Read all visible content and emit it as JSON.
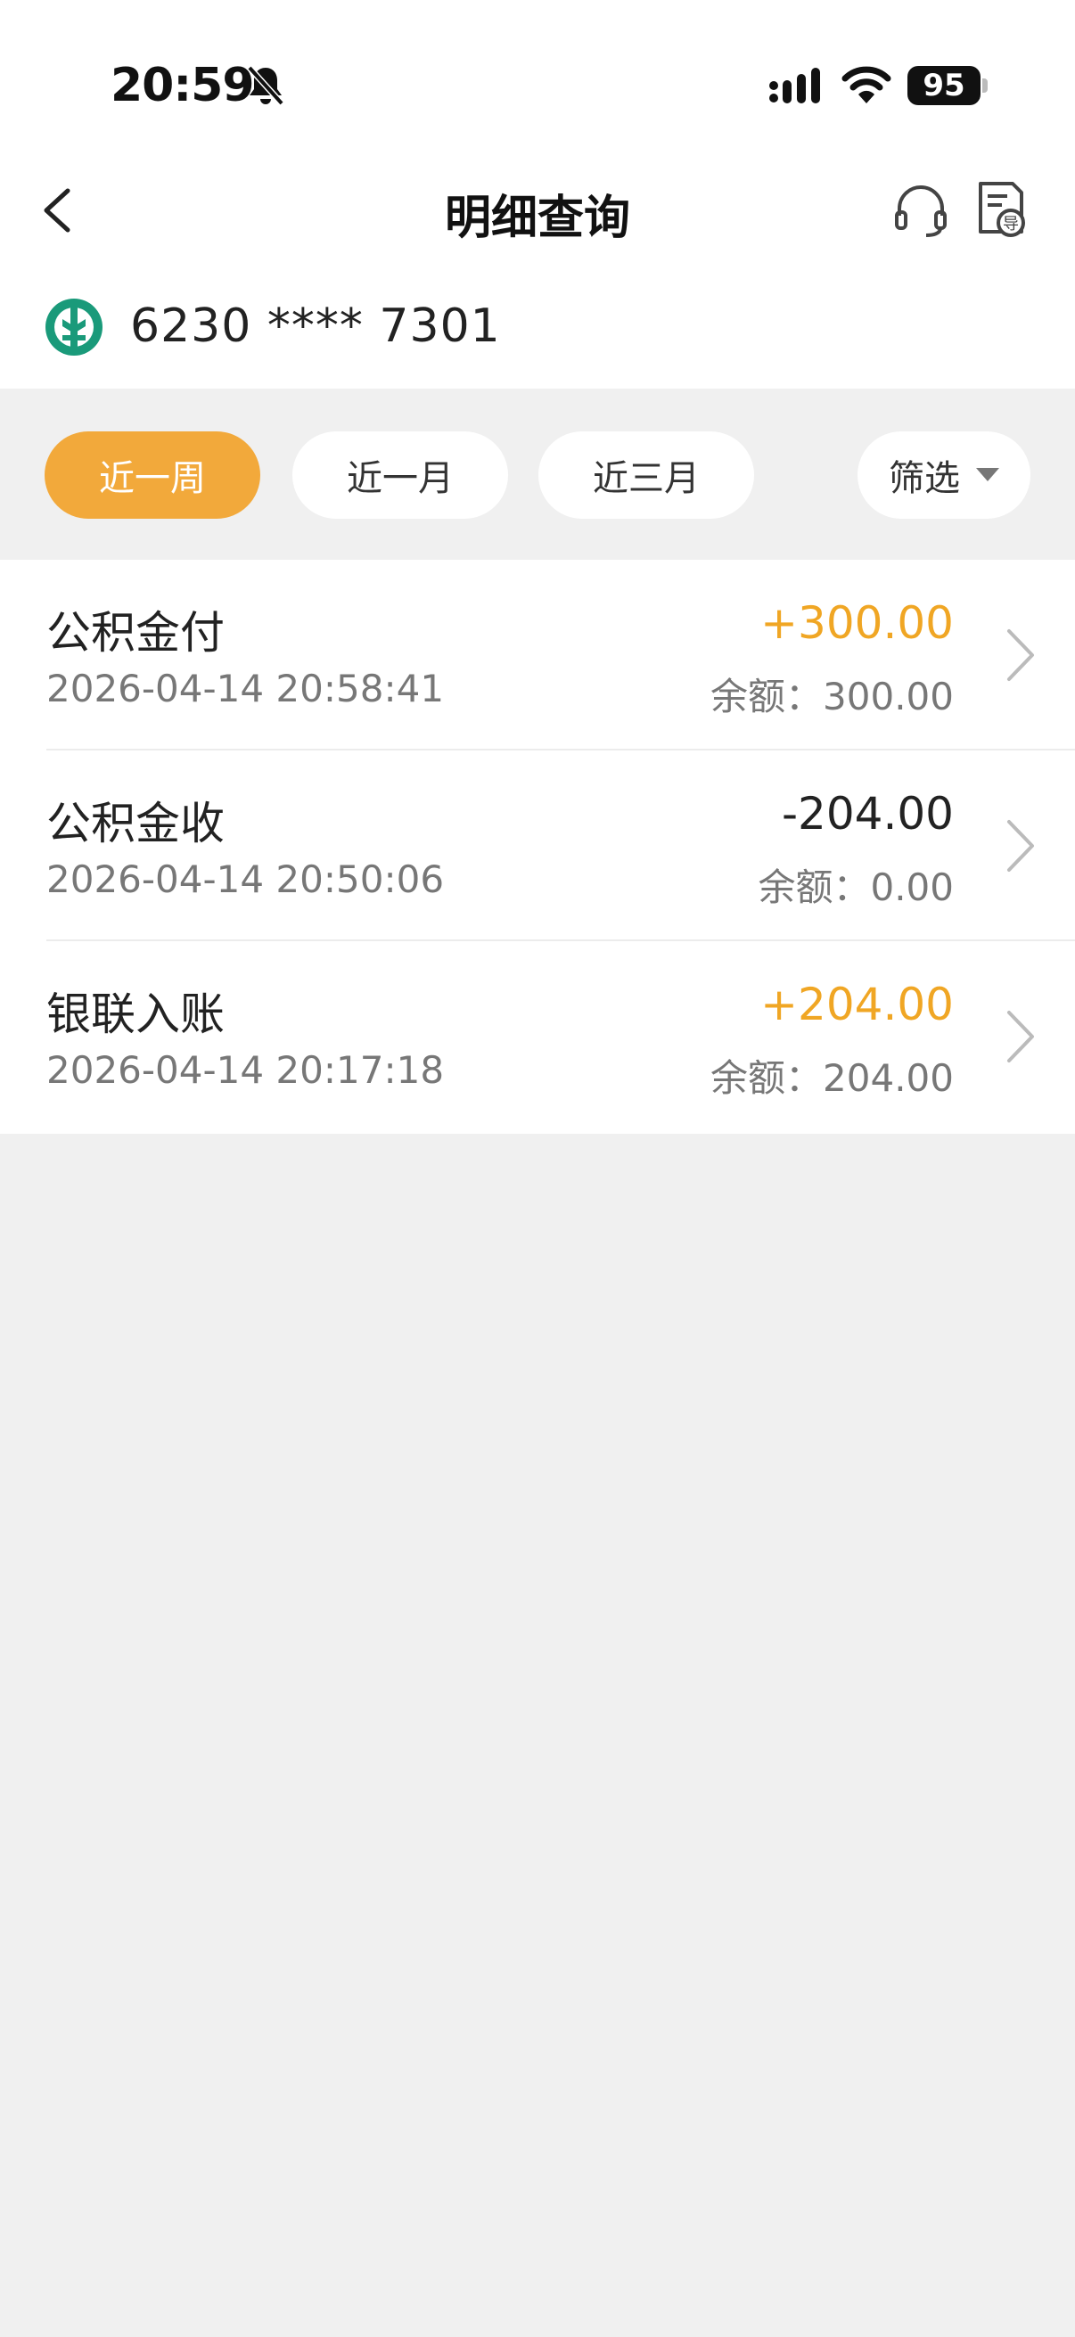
{
  "status_bar": {
    "time": "20:59",
    "battery": "95",
    "icons": [
      "bell-off-icon",
      "signal-icon",
      "wifi-icon",
      "battery-icon"
    ]
  },
  "nav": {
    "title": "明细查询",
    "icons": [
      "back-icon",
      "headset-icon",
      "export-icon"
    ]
  },
  "account": {
    "number": "6230 **** 7301",
    "logo_icon": "bank-logo-icon"
  },
  "filters": {
    "tabs": [
      {
        "label": "近一周",
        "active": true
      },
      {
        "label": "近一月",
        "active": false
      },
      {
        "label": "近三月",
        "active": false
      }
    ],
    "filter_label": "筛选"
  },
  "transactions": [
    {
      "title": "公积金付",
      "time": "2026-04-14 20:58:41",
      "amount": "+300.00",
      "balance": "余额：300.00"
    },
    {
      "title": "公积金收",
      "time": "2026-04-14 20:50:06",
      "amount": "-204.00",
      "balance": "余额：0.00"
    },
    {
      "title": "银联入账",
      "time": "2026-04-14 20:17:18",
      "amount": "+204.00",
      "balance": "余额：204.00"
    }
  ],
  "colors": {
    "accent": "#f2a93b",
    "positive_amount": "#f0a624",
    "background": "#f0f0f0",
    "bank_logo": "#1a9a7a"
  }
}
